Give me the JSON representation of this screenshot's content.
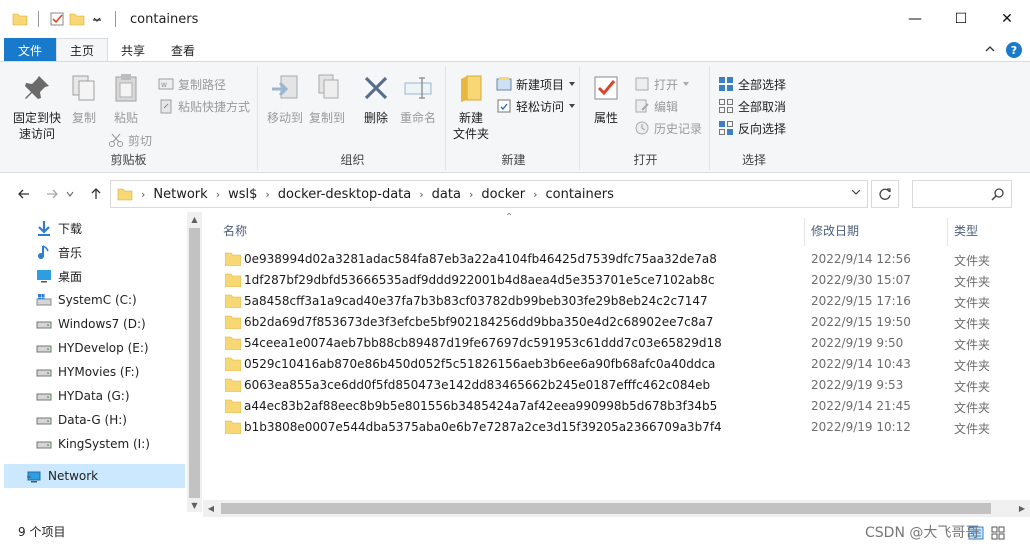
{
  "window": {
    "title": "containers",
    "controls": {
      "minimize": "—",
      "maximize": "☐",
      "close": "✕"
    }
  },
  "ribbon_tabs": [
    {
      "label": "文件"
    },
    {
      "label": "主页"
    },
    {
      "label": "共享"
    },
    {
      "label": "查看"
    }
  ],
  "ribbon": {
    "clipboard": {
      "pin_label_1": "固定到快",
      "pin_label_2": "速访问",
      "copy": "复制",
      "paste": "粘贴",
      "copy_path": "复制路径",
      "paste_shortcut": "粘贴快捷方式",
      "cut": "剪切",
      "group": "剪贴板"
    },
    "organize": {
      "move_to": "移动到",
      "copy_to": "复制到",
      "delete": "删除",
      "rename": "重命名",
      "group": "组织"
    },
    "new": {
      "new_folder_1": "新建",
      "new_folder_2": "文件夹",
      "new_item": "新建项目",
      "easy_access": "轻松访问",
      "group": "新建"
    },
    "open": {
      "properties": "属性",
      "open": "打开",
      "edit": "编辑",
      "history": "历史记录",
      "group": "打开"
    },
    "select": {
      "select_all": "全部选择",
      "select_none": "全部取消",
      "invert": "反向选择",
      "group": "选择"
    }
  },
  "breadcrumb": [
    "Network",
    "wsl$",
    "docker-desktop-data",
    "data",
    "docker",
    "containers"
  ],
  "sidebar": {
    "items": [
      {
        "label": "下载",
        "icon": "download-icon"
      },
      {
        "label": "音乐",
        "icon": "music-icon"
      },
      {
        "label": "桌面",
        "icon": "desktop-icon"
      },
      {
        "label": "SystemC (C:)",
        "icon": "system-drive-icon"
      },
      {
        "label": "Windows7 (D:)",
        "icon": "drive-icon"
      },
      {
        "label": "HYDevelop (E:)",
        "icon": "drive-icon"
      },
      {
        "label": "HYMovies (F:)",
        "icon": "drive-icon"
      },
      {
        "label": "HYData (G:)",
        "icon": "drive-icon"
      },
      {
        "label": "Data-G (H:)",
        "icon": "drive-icon"
      },
      {
        "label": "KingSystem (I:)",
        "icon": "drive-icon"
      },
      {
        "label": "Network",
        "icon": "network-icon"
      }
    ]
  },
  "columns": {
    "name": "名称",
    "date": "修改日期",
    "type": "类型"
  },
  "files": [
    {
      "name": "0e938994d02a3281adac584fa87eb3a22a4104fb46425d7539dfc75aa32de7a8",
      "date": "2022/9/14 12:56",
      "type": "文件夹"
    },
    {
      "name": "1df287bf29dbfd53666535adf9ddd922001b4d8aea4d5e353701e5ce7102ab8c",
      "date": "2022/9/30 15:07",
      "type": "文件夹"
    },
    {
      "name": "5a8458cff3a1a9cad40e37fa7b3b83cf03782db99beb303fe29b8eb24c2c7147",
      "date": "2022/9/15 17:16",
      "type": "文件夹"
    },
    {
      "name": "6b2da69d7f853673de3f3efcbe5bf902184256dd9bba350e4d2c68902ee7c8a7",
      "date": "2022/9/15 19:50",
      "type": "文件夹"
    },
    {
      "name": "54ceea1e0074aeb7bb88cb89487d19fe67697dc591953c61ddd7c03e65829d18",
      "date": "2022/9/19 9:50",
      "type": "文件夹"
    },
    {
      "name": "0529c10416ab870e86b450d052f5c51826156aeb3b6ee6a90fb68afc0a40ddca",
      "date": "2022/9/14 10:43",
      "type": "文件夹"
    },
    {
      "name": "6063ea855a3ce6dd0f5fd850473e142dd83465662b245e0187efffc462c084eb",
      "date": "2022/9/19 9:53",
      "type": "文件夹"
    },
    {
      "name": "a44ec83b2af88eec8b9b5e801556b3485424a7af42eea990998b5d678b3f34b5",
      "date": "2022/9/14 21:45",
      "type": "文件夹"
    },
    {
      "name": "b1b3808e0007e544dba5375aba0e6b7e7287a2ce3d15f39205a2366709a3b7f4",
      "date": "2022/9/19 10:12",
      "type": "文件夹"
    }
  ],
  "status": {
    "count": "9 个项目"
  },
  "watermark": "CSDN @大飞哥哥",
  "colors": {
    "accent": "#1979ca",
    "folder": "#f8d775",
    "selection": "#cce8ff"
  }
}
